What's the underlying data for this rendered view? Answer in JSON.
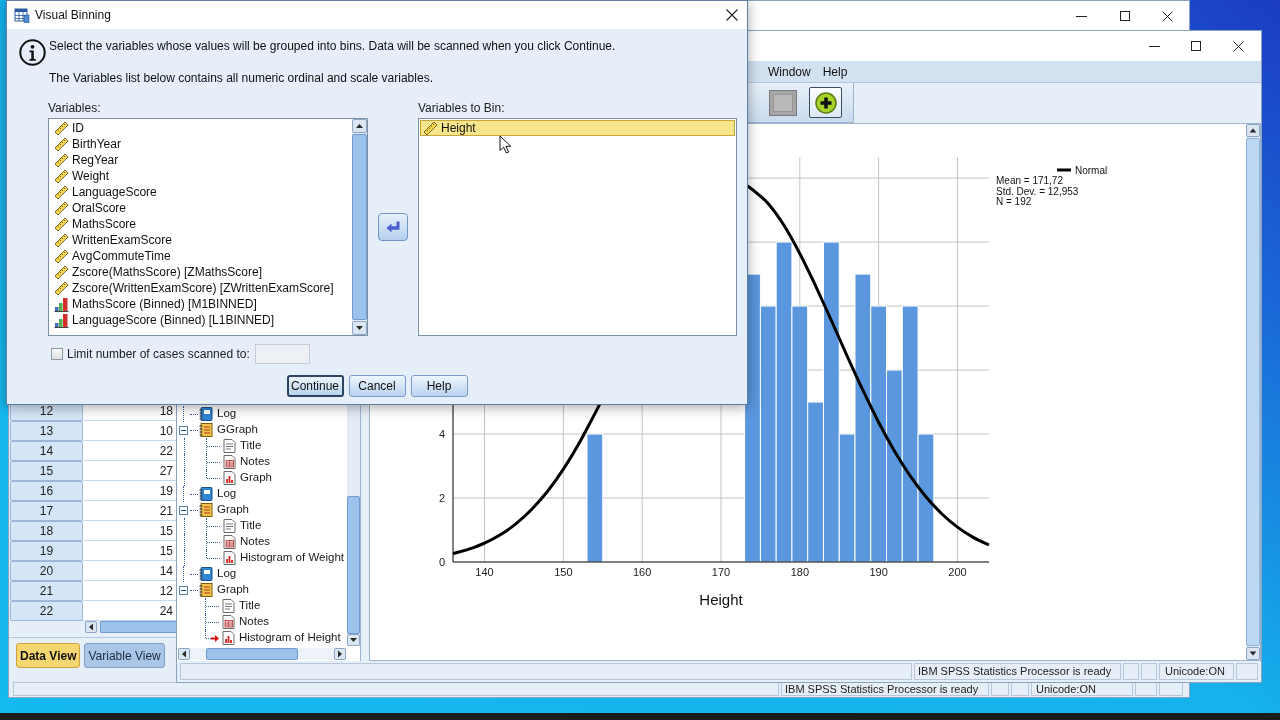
{
  "dialog": {
    "title": "Visual Binning",
    "info": [
      "Select the variables whose values will be grouped into bins. Data will be scanned when you click Continue.",
      "The Variables list below contains all numeric ordinal and scale variables."
    ],
    "variables_label": "Variables:",
    "variables": [
      {
        "name": "ID",
        "kind": "scale",
        "selected": false
      },
      {
        "name": "BirthYear",
        "kind": "scale",
        "selected": false
      },
      {
        "name": "RegYear",
        "kind": "scale",
        "selected": false
      },
      {
        "name": "Weight",
        "kind": "scale",
        "selected": false
      },
      {
        "name": "LanguageScore",
        "kind": "scale",
        "selected": false
      },
      {
        "name": "OralScore",
        "kind": "scale",
        "selected": false
      },
      {
        "name": "MathsScore",
        "kind": "scale",
        "selected": false
      },
      {
        "name": "WrittenExamScore",
        "kind": "scale",
        "selected": false
      },
      {
        "name": "AvgCommuteTime",
        "kind": "scale",
        "selected": false
      },
      {
        "name": "Zscore(MathsScore) [ZMathsScore]",
        "kind": "scale",
        "selected": false
      },
      {
        "name": "Zscore(WrittenExamScore) [ZWrittenExamScore]",
        "kind": "scale",
        "selected": false
      },
      {
        "name": "MathsScore (Binned) [M1BINNED]",
        "kind": "ordinal",
        "selected": false
      },
      {
        "name": "LanguageScore (Binned) [L1BINNED]",
        "kind": "ordinal",
        "selected": false
      }
    ],
    "bin_label": "Variables to Bin:",
    "to_bin": [
      {
        "name": "Height",
        "kind": "scale",
        "selected": true
      }
    ],
    "limit": {
      "label": "Limit number of cases scanned to:",
      "checked": false,
      "field_disabled": true
    },
    "buttons": [
      {
        "label": "Continue",
        "default": true
      },
      {
        "label": "Cancel",
        "default": false
      },
      {
        "label": "Help",
        "default": false
      }
    ]
  },
  "output_viewer": {
    "menu": [
      "Window",
      "Help"
    ],
    "outline": [
      {
        "label": "Log",
        "kind": "log",
        "current": false
      },
      {
        "label": "GGraph",
        "kind": "heading",
        "expanded": true,
        "current": false,
        "children": [
          {
            "label": "Title",
            "kind": "title",
            "current": false
          },
          {
            "label": "Notes",
            "kind": "notes",
            "current": false
          },
          {
            "label": "Graph",
            "kind": "chart",
            "current": false
          }
        ]
      },
      {
        "label": "Log",
        "kind": "log",
        "current": false
      },
      {
        "label": "Graph",
        "kind": "heading",
        "expanded": true,
        "current": false,
        "children": [
          {
            "label": "Title",
            "kind": "title",
            "current": false
          },
          {
            "label": "Notes",
            "kind": "notes",
            "current": false
          },
          {
            "label": "Histogram of Weight",
            "kind": "chart",
            "current": false
          }
        ]
      },
      {
        "label": "Log",
        "kind": "log",
        "current": false
      },
      {
        "label": "Graph",
        "kind": "heading",
        "expanded": true,
        "current": false,
        "children": [
          {
            "label": "Title",
            "kind": "title",
            "current": false
          },
          {
            "label": "Notes",
            "kind": "notes",
            "current": false
          },
          {
            "label": "Histogram of Height",
            "kind": "chart",
            "current": true
          }
        ]
      }
    ],
    "chart": {
      "statistics": [
        "Mean = 171,72",
        "Std. Dev. = 12,953",
        "N = 192"
      ],
      "chart_data": {
        "type": "bar",
        "xlabel": "Height",
        "x": [
          136,
          138,
          140,
          142,
          144,
          146,
          148,
          150,
          152,
          154,
          174,
          176,
          178,
          180,
          182,
          184,
          186,
          188,
          190,
          192,
          194,
          196,
          198,
          200,
          202,
          204
        ],
        "series": [
          {
            "color": "#5b97de",
            "values": [
              null,
              null,
              null,
              null,
              null,
              null,
              null,
              null,
              null,
              4,
              9,
              8,
              10,
              8,
              5,
              10,
              4,
              9,
              8,
              6,
              8,
              4,
              null,
              null,
              null,
              null
            ]
          },
          {
            "type": "line",
            "name": "Normal",
            "color": "#000000",
            "values": [
              0.26,
              0.4,
              0.59,
              0.85,
              1.2,
              1.65,
              2.21,
              2.9,
              3.71,
              4.64,
              11.64,
              11.2,
              10.52,
              9.64,
              8.63,
              7.55,
              6.44,
              5.37,
              4.37,
              3.47,
              2.69,
              2.04,
              1.51,
              1.09,
              0.77,
              0.53
            ]
          }
        ],
        "xlim": [
          136,
          204
        ],
        "ylim": [
          0,
          12.66
        ],
        "xticks": [
          140,
          150,
          160,
          170,
          180,
          190,
          200
        ],
        "yticks": [
          0,
          2,
          4
        ],
        "grid": true
      }
    },
    "status_bar": {
      "message": "IBM SPSS Statistics Processor is ready",
      "encoding": "Unicode:ON"
    }
  },
  "data_editor": {
    "rows": [
      {
        "number": "12",
        "value": "18"
      },
      {
        "number": "13",
        "value": "10"
      },
      {
        "number": "14",
        "value": "22"
      },
      {
        "number": "15",
        "value": "27"
      },
      {
        "number": "16",
        "value": "19"
      },
      {
        "number": "17",
        "value": "21"
      },
      {
        "number": "18",
        "value": "15"
      },
      {
        "number": "19",
        "value": "15"
      },
      {
        "number": "20",
        "value": "14"
      },
      {
        "number": "21",
        "value": "12"
      },
      {
        "number": "22",
        "value": "24"
      }
    ],
    "tabs": [
      {
        "label": "Data View",
        "selected": true
      },
      {
        "label": "Variable View",
        "selected": false
      }
    ],
    "status_bar": {
      "message": "IBM SPSS Statistics Processor is ready",
      "encoding": "Unicode:ON"
    }
  }
}
